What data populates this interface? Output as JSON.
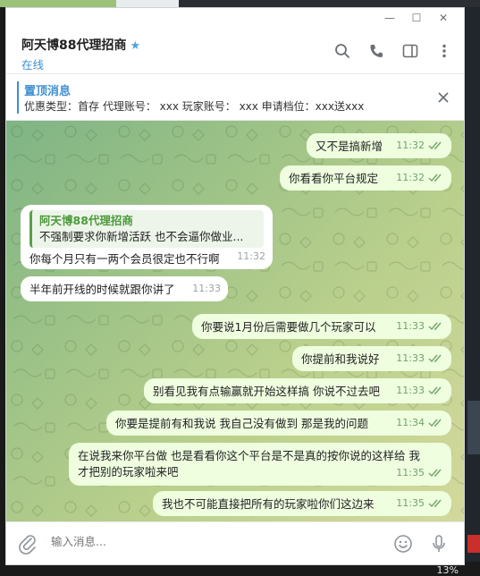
{
  "window": {
    "min": "—",
    "max": "☐",
    "close": "✕"
  },
  "header": {
    "title": "阿天博88代理招商",
    "status": "在线"
  },
  "pinned": {
    "title": "置顶消息",
    "text": "优惠类型：首存 代理账号： xxx  玩家账号：  xxx 申请档位：xxx送xxx"
  },
  "messages": [
    {
      "text": "又不是搞新增",
      "time": "11:32"
    },
    {
      "text": "你看看你平台规定",
      "time": "11:32"
    },
    {
      "quote_name": "阿天博88代理招商",
      "quote_text": "不强制要求你新增活跃 也不会逼你做业...",
      "text": "你每个月只有一两个会员很定也不行啊",
      "time": "11:32"
    },
    {
      "text": "半年前开线的时候就跟你讲了",
      "time": "11:33"
    },
    {
      "text": "你要说1月份后需要做几个玩家可以",
      "time": "11:33"
    },
    {
      "text": "你提前和我说好",
      "time": "11:33"
    },
    {
      "text": "别看见我有点输赢就开始这样搞 你说不过去吧",
      "time": "11:33"
    },
    {
      "text": "你要是提前有和我说 我自己没有做到 那是我的问题",
      "time": "11:34"
    },
    {
      "text_line1": "在说我来你平台做 也是看看你这个平台是不是真的按你说的这样给 我",
      "text_line2": "才把别的玩家啦来吧",
      "time": "11:35"
    },
    {
      "text": "我也不可能直接把所有的玩家啦你们这边来",
      "time": "11:35"
    }
  ],
  "composer": {
    "placeholder": "输入消息..."
  },
  "tray": {
    "battery": "13%"
  },
  "colors": {
    "accent": "#3f8fd1",
    "outgoing": "#eefedf",
    "check": "#72a36a"
  },
  "icons": [
    "search-icon",
    "phone-icon",
    "sidebar-toggle-icon",
    "more-icon",
    "close-icon",
    "paperclip-icon",
    "emoji-icon",
    "microphone-icon",
    "double-check-icon",
    "star-icon"
  ]
}
